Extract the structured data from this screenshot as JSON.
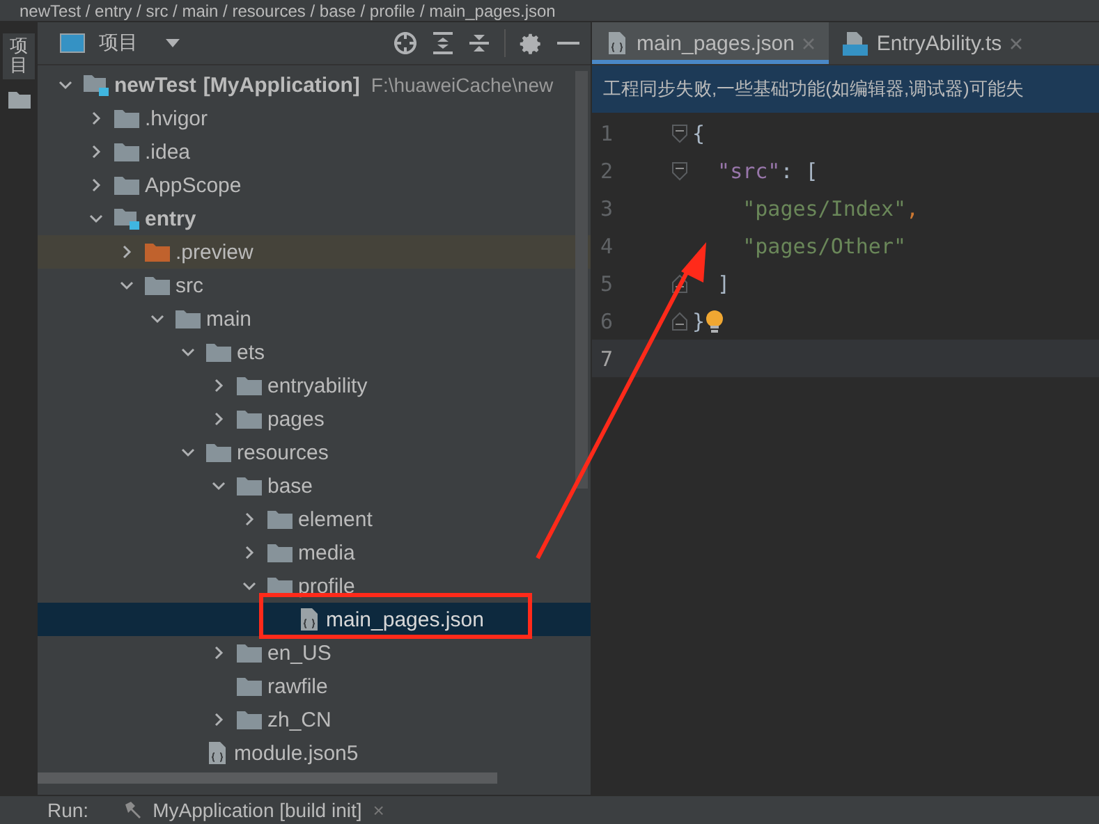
{
  "breadcrumb": "newTest / entry / src / main / resources / base / profile / main_pages.json",
  "tool_strip": {
    "label": "项目",
    "selected": true
  },
  "project_panel": {
    "title": "项目",
    "tree": [
      {
        "label": "newTest",
        "module_name": "[MyApplication]",
        "path": "F:\\huaweiCache\\new",
        "kind": "module",
        "expanded": true,
        "selected": false,
        "children": [
          {
            "label": ".hvigor",
            "kind": "folder",
            "expanded": false,
            "selected": false
          },
          {
            "label": ".idea",
            "kind": "folder",
            "expanded": false,
            "selected": false
          },
          {
            "label": "AppScope",
            "kind": "folder",
            "expanded": false,
            "selected": false
          },
          {
            "label": "entry",
            "kind": "module-folder",
            "expanded": true,
            "selected": false,
            "children": [
              {
                "label": ".preview",
                "kind": "excluded-folder",
                "expanded": false,
                "selected": false
              },
              {
                "label": "src",
                "kind": "folder",
                "expanded": true,
                "selected": false,
                "children": [
                  {
                    "label": "main",
                    "kind": "folder",
                    "expanded": true,
                    "selected": false,
                    "children": [
                      {
                        "label": "ets",
                        "kind": "folder",
                        "expanded": true,
                        "selected": false,
                        "children": [
                          {
                            "label": "entryability",
                            "kind": "folder",
                            "expanded": false,
                            "selected": false
                          },
                          {
                            "label": "pages",
                            "kind": "folder",
                            "expanded": false,
                            "selected": false
                          }
                        ]
                      },
                      {
                        "label": "resources",
                        "kind": "folder",
                        "expanded": true,
                        "selected": false,
                        "children": [
                          {
                            "label": "base",
                            "kind": "folder",
                            "expanded": true,
                            "selected": false,
                            "children": [
                              {
                                "label": "element",
                                "kind": "folder",
                                "expanded": false,
                                "selected": false
                              },
                              {
                                "label": "media",
                                "kind": "folder",
                                "expanded": false,
                                "selected": false
                              },
                              {
                                "label": "profile",
                                "kind": "folder",
                                "expanded": true,
                                "selected": false,
                                "children": [
                                  {
                                    "label": "main_pages.json",
                                    "kind": "json-file",
                                    "selected": true
                                  }
                                ]
                              }
                            ]
                          },
                          {
                            "label": "en_US",
                            "kind": "folder",
                            "expanded": false,
                            "selected": false
                          },
                          {
                            "label": "rawfile",
                            "kind": "folder",
                            "selected": false
                          },
                          {
                            "label": "zh_CN",
                            "kind": "folder",
                            "expanded": false,
                            "selected": false
                          }
                        ]
                      },
                      {
                        "label": "module.json5",
                        "kind": "json-file",
                        "selected": false
                      }
                    ]
                  }
                ]
              }
            ]
          }
        ]
      }
    ]
  },
  "editor": {
    "tabs": [
      {
        "label": "main_pages.json",
        "kind": "json",
        "selected": true
      },
      {
        "label": "EntryAbility.ts",
        "kind": "ts",
        "selected": false
      }
    ],
    "notification": "工程同步失败,一些基础功能(如编辑器,调试器)可能失",
    "lines": [
      {
        "number": "1",
        "fold_start": true,
        "fold_end": false,
        "current": false,
        "bulb": false,
        "tokens": [
          {
            "kind": "punct",
            "text": "{"
          }
        ]
      },
      {
        "number": "2",
        "fold_start": true,
        "fold_end": false,
        "current": false,
        "bulb": false,
        "tokens": [
          {
            "kind": "key",
            "text": "  \"src\""
          },
          {
            "kind": "punct",
            "text": ": ["
          }
        ]
      },
      {
        "number": "3",
        "fold_start": false,
        "fold_end": false,
        "current": false,
        "bulb": false,
        "tokens": [
          {
            "kind": "string",
            "text": "    \"pages/Index\""
          },
          {
            "kind": "comma",
            "text": ","
          }
        ]
      },
      {
        "number": "4",
        "fold_start": false,
        "fold_end": false,
        "current": false,
        "bulb": false,
        "tokens": [
          {
            "kind": "string",
            "text": "    \"pages/Other\""
          }
        ]
      },
      {
        "number": "5",
        "fold_start": false,
        "fold_end": true,
        "current": false,
        "bulb": false,
        "tokens": [
          {
            "kind": "punct",
            "text": "  ]"
          }
        ]
      },
      {
        "number": "6",
        "fold_start": false,
        "fold_end": true,
        "current": false,
        "bulb": true,
        "tokens": [
          {
            "kind": "punct",
            "text": "}"
          }
        ]
      },
      {
        "number": "7",
        "fold_start": false,
        "fold_end": false,
        "current": true,
        "bulb": false
      }
    ]
  },
  "run_bar": {
    "label": "Run:",
    "config": "MyApplication [build init]",
    "close": "×"
  }
}
